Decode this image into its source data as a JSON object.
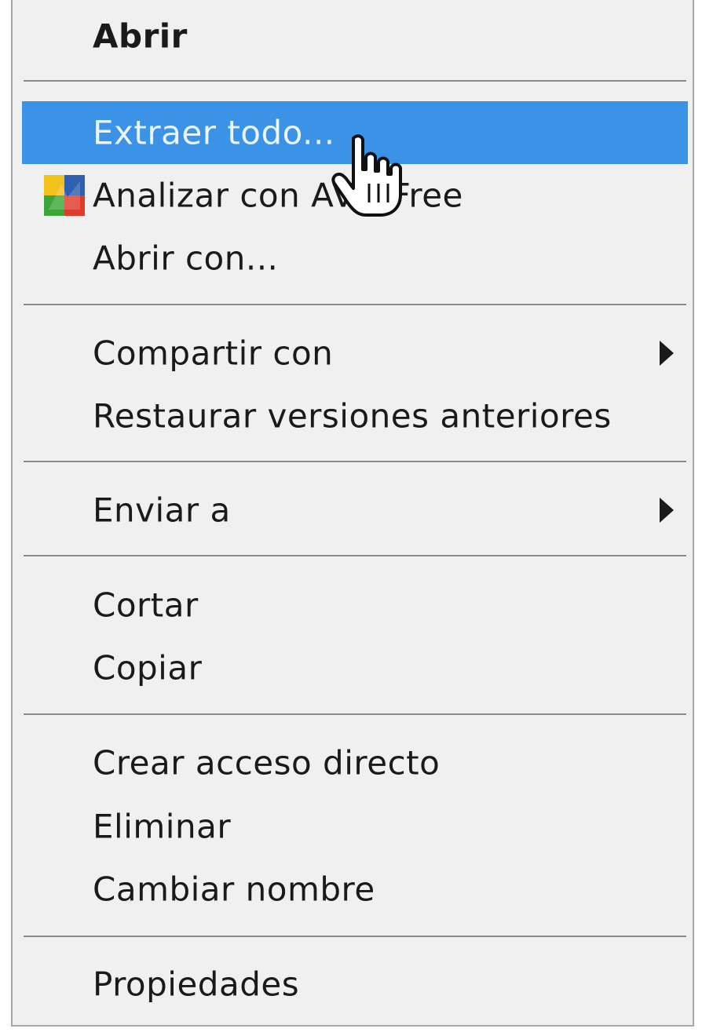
{
  "menu": {
    "items": [
      {
        "label": "Abrir"
      },
      {
        "label": "Extraer todo..."
      },
      {
        "label": "Analizar con AVG Free",
        "icon": "avg-antivirus-icon"
      },
      {
        "label": "Abrir con..."
      },
      {
        "label": "Compartir con",
        "submenu": true
      },
      {
        "label": "Restaurar versiones anteriores"
      },
      {
        "label": "Enviar a",
        "submenu": true
      },
      {
        "label": "Cortar"
      },
      {
        "label": "Copiar"
      },
      {
        "label": "Crear acceso directo"
      },
      {
        "label": "Eliminar"
      },
      {
        "label": "Cambiar nombre"
      },
      {
        "label": "Propiedades"
      }
    ],
    "highlighted_item": "Extraer todo..."
  },
  "colors": {
    "menu_background": "#f0f0f0",
    "highlight": "#3b93e8",
    "text": "#1a1a1a",
    "separator": "#8a8a8a"
  },
  "cursor": {
    "icon": "hand-pointer-icon"
  }
}
